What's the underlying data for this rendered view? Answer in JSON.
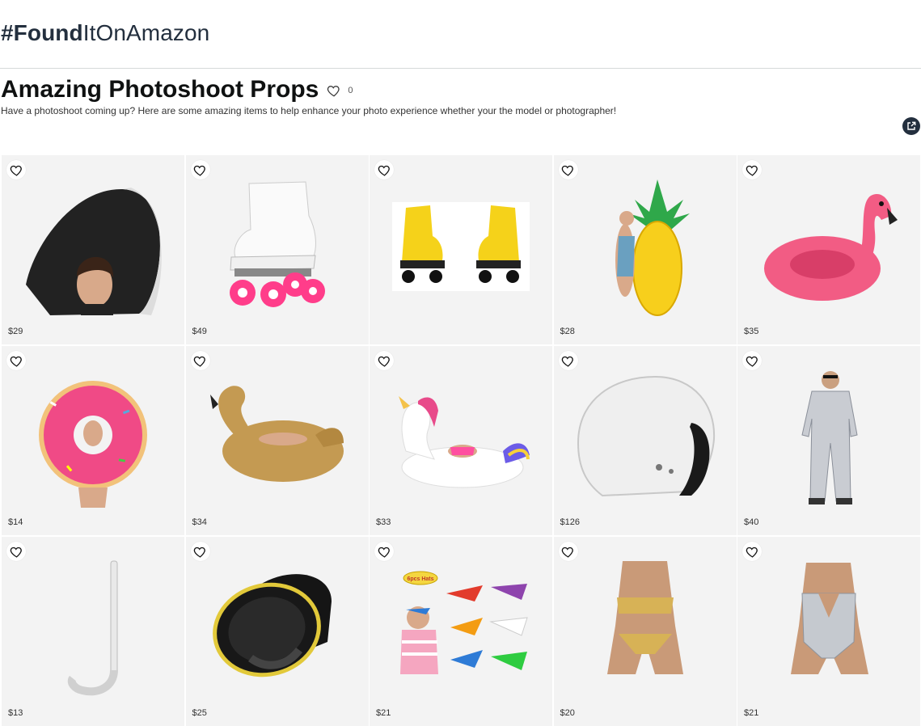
{
  "header": {
    "brand_bold": "#Found",
    "brand_light": "ItOnAmazon"
  },
  "list": {
    "title": "Amazing Photoshoot Props",
    "like_count": "0",
    "description": "Have a photoshoot coming up? Here are some amazing items to help enhance your photo experience whether your the model or photographer!"
  },
  "colors": {
    "brand_dark": "#232f3e",
    "card_bg": "#f3f3f3"
  },
  "products": [
    {
      "name": "Black Wide Brim Hat",
      "price": "$29",
      "icon": "hat-image"
    },
    {
      "name": "White Roller Skates",
      "price": "$49",
      "icon": "roller-skate-image"
    },
    {
      "name": "Yellow Roller Skates",
      "price": "",
      "icon": "yellow-skates-image"
    },
    {
      "name": "Pineapple Float",
      "price": "$28",
      "icon": "pineapple-float-image"
    },
    {
      "name": "Pink Flamingo Float",
      "price": "$35",
      "icon": "flamingo-float-image"
    },
    {
      "name": "Donut Float",
      "price": "$14",
      "icon": "donut-float-image"
    },
    {
      "name": "Gold Swan Float",
      "price": "$34",
      "icon": "swan-float-image"
    },
    {
      "name": "Unicorn Float",
      "price": "$33",
      "icon": "unicorn-float-image"
    },
    {
      "name": "White Helmet",
      "price": "$126",
      "icon": "helmet-image"
    },
    {
      "name": "Silver Astronaut Costume",
      "price": "$40",
      "icon": "astronaut-costume-image"
    },
    {
      "name": "Snorkel",
      "price": "$13",
      "icon": "snorkel-image"
    },
    {
      "name": "Dive Mask",
      "price": "$25",
      "icon": "dive-mask-image"
    },
    {
      "name": "Visor Hats",
      "price": "$21",
      "icon": "visor-hats-image",
      "badge": "6pcs Hats"
    },
    {
      "name": "Gold Bikini",
      "price": "$20",
      "icon": "gold-bikini-image"
    },
    {
      "name": "Silver Swimsuit",
      "price": "$21",
      "icon": "silver-swimsuit-image"
    }
  ]
}
